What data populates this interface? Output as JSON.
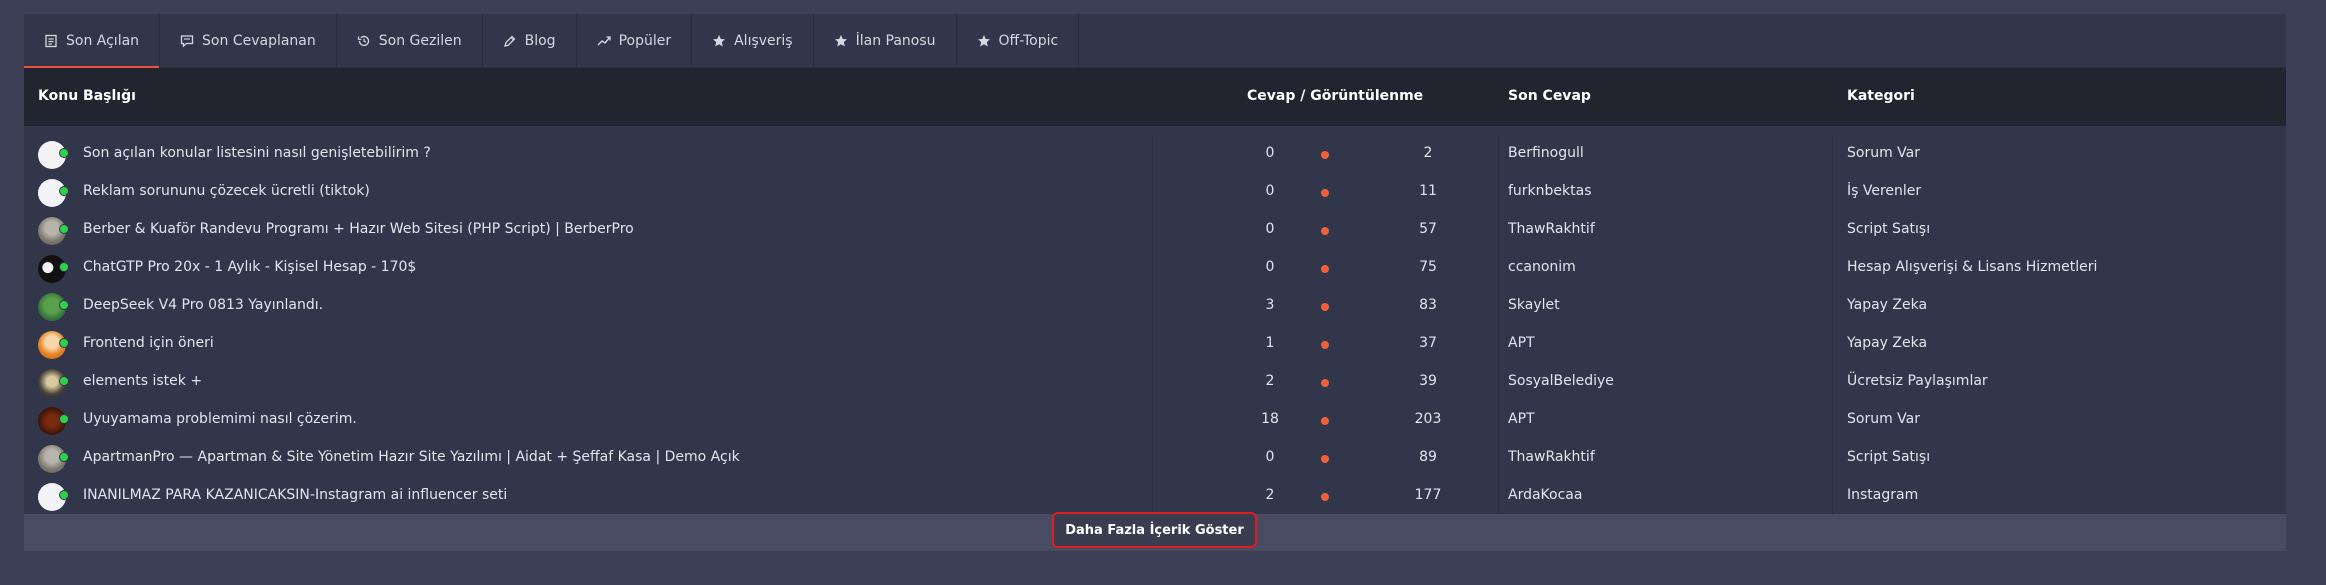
{
  "tabs": [
    {
      "label": "Son Açılan",
      "icon": "document-icon",
      "active": true
    },
    {
      "label": "Son Cevaplanan",
      "icon": "comment-icon",
      "active": false
    },
    {
      "label": "Son Gezilen",
      "icon": "history-icon",
      "active": false
    },
    {
      "label": "Blog",
      "icon": "pen-icon",
      "active": false
    },
    {
      "label": "Popüler",
      "icon": "trend-icon",
      "active": false
    },
    {
      "label": "Alışveriş",
      "icon": "star-icon",
      "active": false
    },
    {
      "label": "İlan Panosu",
      "icon": "star-icon",
      "active": false
    },
    {
      "label": "Off-Topic",
      "icon": "star-icon",
      "active": false
    }
  ],
  "table": {
    "headers": {
      "topic": "Konu Başlığı",
      "stats": "Cevap / Görüntülenme",
      "last_reply": "Son Cevap",
      "category": "Kategori"
    },
    "rows": [
      {
        "title": "Son açılan konular listesini nasıl genişletebilirim ?",
        "replies": "0",
        "views": "2",
        "last_reply": "Berfinogull",
        "category": "Sorum Var",
        "avatar": "blank"
      },
      {
        "title": "Reklam sorununu çözecek ücretli (tiktok)",
        "replies": "0",
        "views": "11",
        "last_reply": "furknbektas",
        "category": "İş Verenler",
        "avatar": "blank"
      },
      {
        "title": "Berber & Kuaför Randevu Programı + Hazır Web Sitesi (PHP Script) | BerberPro",
        "replies": "0",
        "views": "57",
        "last_reply": "ThawRakhtif",
        "category": "Script Satışı",
        "avatar": "photo"
      },
      {
        "title": "ChatGTP Pro 20x - 1 Aylık - Kişisel Hesap - 170$",
        "replies": "0",
        "views": "75",
        "last_reply": "ccanonim",
        "category": "Hesap Alışverişi & Lisans Hizmetleri",
        "avatar": "dark"
      },
      {
        "title": "DeepSeek V4 Pro 0813 Yayınlandı.",
        "replies": "3",
        "views": "83",
        "last_reply": "Skaylet",
        "category": "Yapay Zeka",
        "avatar": "green"
      },
      {
        "title": "Frontend için öneri",
        "replies": "1",
        "views": "37",
        "last_reply": "APT",
        "category": "Yapay Zeka",
        "avatar": "orange"
      },
      {
        "title": "elements istek +",
        "replies": "2",
        "views": "39",
        "last_reply": "SosyalBelediye",
        "category": "Ücretsiz Paylaşımlar",
        "avatar": "photo2"
      },
      {
        "title": "Uyuyamama problemimi nasıl çözerim.",
        "replies": "18",
        "views": "203",
        "last_reply": "APT",
        "category": "Sorum Var",
        "avatar": "brown"
      },
      {
        "title": "ApartmanPro — Apartman & Site Yönetim Hazır Site Yazılımı | Aidat + Şeffaf Kasa | Demo Açık",
        "replies": "0",
        "views": "89",
        "last_reply": "ThawRakhtif",
        "category": "Script Satışı",
        "avatar": "photo"
      },
      {
        "title": "INANILMAZ PARA KAZANICAKSIN-Instagram ai influencer seti",
        "replies": "2",
        "views": "177",
        "last_reply": "ArdaKocaa",
        "category": "Instagram",
        "avatar": "blank"
      }
    ]
  },
  "footer": {
    "more_label": "Daha Fazla İçerik Göster"
  },
  "colors": {
    "accent": "#e8523a",
    "online": "#2dd14a",
    "highlight_border": "#e01c1c"
  }
}
